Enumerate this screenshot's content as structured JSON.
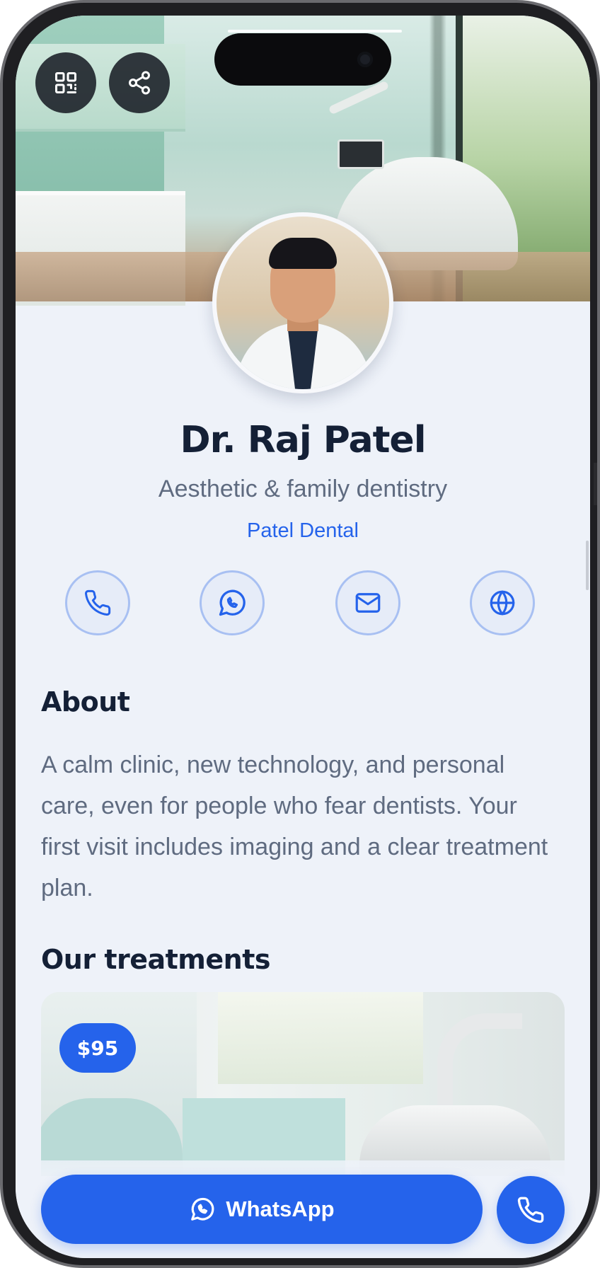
{
  "header": {
    "qr_icon": "qr-code-icon",
    "share_icon": "share-icon"
  },
  "profile": {
    "name": "Dr. Raj Patel",
    "subtitle": "Aesthetic & family dentistry",
    "company": "Patel Dental"
  },
  "actions": [
    {
      "icon": "phone-icon"
    },
    {
      "icon": "whatsapp-icon"
    },
    {
      "icon": "mail-icon"
    },
    {
      "icon": "globe-icon"
    }
  ],
  "about": {
    "title": "About",
    "text": "A calm clinic, new technology, and personal care, even for people who fear dentists. Your first visit includes imaging and a clear treatment plan."
  },
  "treatments": {
    "title": "Our treatments",
    "items": [
      {
        "price": "$95"
      }
    ]
  },
  "bottom_bar": {
    "whatsapp_label": "WhatsApp",
    "call_icon": "phone-icon"
  },
  "colors": {
    "accent": "#2563eb",
    "heading": "#142036",
    "muted": "#5f6b80",
    "background": "#eef2f9"
  }
}
